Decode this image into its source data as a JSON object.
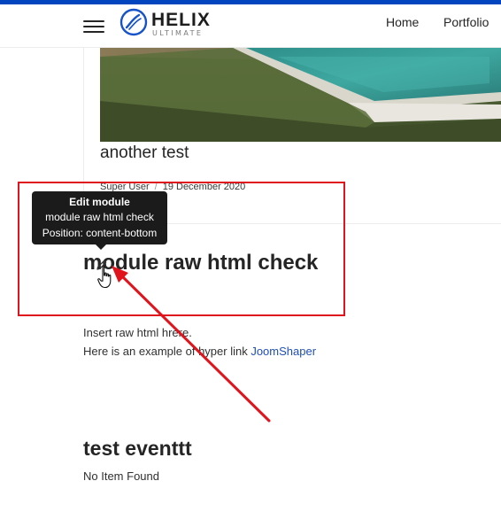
{
  "header": {
    "logo_name": "HELIX",
    "logo_sub": "ULTIMATE",
    "nav": [
      {
        "label": "Home"
      },
      {
        "label": "Portfolio"
      }
    ]
  },
  "article": {
    "title": "another test",
    "author": "Super User",
    "separator": "/",
    "date": "19 December 2020"
  },
  "tooltip": {
    "title": "Edit module",
    "module_name": "module raw html check",
    "position": "Position: content-bottom"
  },
  "module": {
    "title": "module raw html check",
    "line1": "Insert raw html hrere.",
    "line2_prefix": "Here is an example of hyper link ",
    "link_text": "JoomShaper"
  },
  "events": {
    "title": "test eventtt",
    "empty_text": "No Item Found"
  },
  "colors": {
    "brand_blue": "#0345bf",
    "annotation_red": "#e0141c",
    "link_blue": "#1f4fb7",
    "tooltip_bg": "#1b1b1b"
  },
  "icons": {
    "menu": "hamburger-icon",
    "edit": "pencil-icon",
    "cursor": "hand-cursor-icon"
  }
}
